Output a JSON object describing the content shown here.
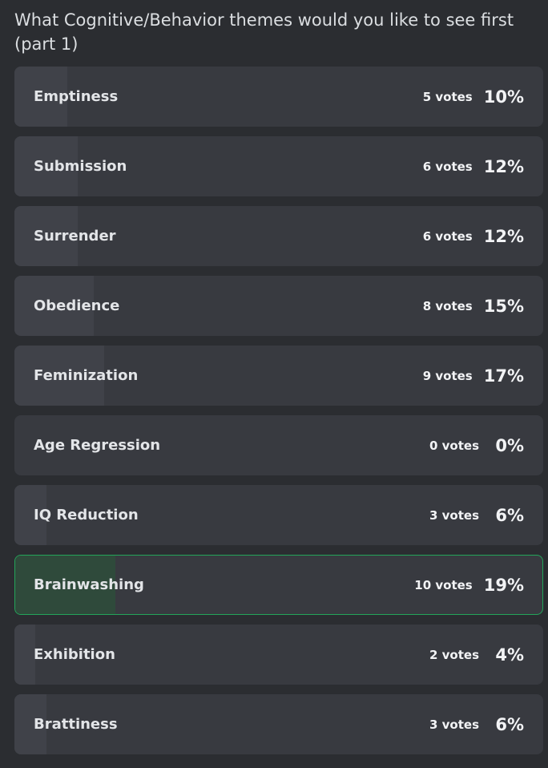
{
  "poll": {
    "question": "What Cognitive/Behavior themes would you like to see first (part 1)",
    "accent_color": "#23a55a",
    "options": [
      {
        "label": "Emptiness",
        "votes": "5 votes",
        "percent": "10%",
        "share": 10,
        "selected": false
      },
      {
        "label": "Submission",
        "votes": "6 votes",
        "percent": "12%",
        "share": 12,
        "selected": false
      },
      {
        "label": "Surrender",
        "votes": "6 votes",
        "percent": "12%",
        "share": 12,
        "selected": false
      },
      {
        "label": "Obedience",
        "votes": "8 votes",
        "percent": "15%",
        "share": 15,
        "selected": false
      },
      {
        "label": "Feminization",
        "votes": "9 votes",
        "percent": "17%",
        "share": 17,
        "selected": false
      },
      {
        "label": "Age Regression",
        "votes": "0 votes",
        "percent": "0%",
        "share": 0,
        "selected": false
      },
      {
        "label": "IQ Reduction",
        "votes": "3 votes",
        "percent": "6%",
        "share": 6,
        "selected": false
      },
      {
        "label": "Brainwashing",
        "votes": "10 votes",
        "percent": "19%",
        "share": 19,
        "selected": true
      },
      {
        "label": "Exhibition",
        "votes": "2 votes",
        "percent": "4%",
        "share": 4,
        "selected": false
      },
      {
        "label": "Brattiness",
        "votes": "3 votes",
        "percent": "6%",
        "share": 6,
        "selected": false
      }
    ]
  }
}
